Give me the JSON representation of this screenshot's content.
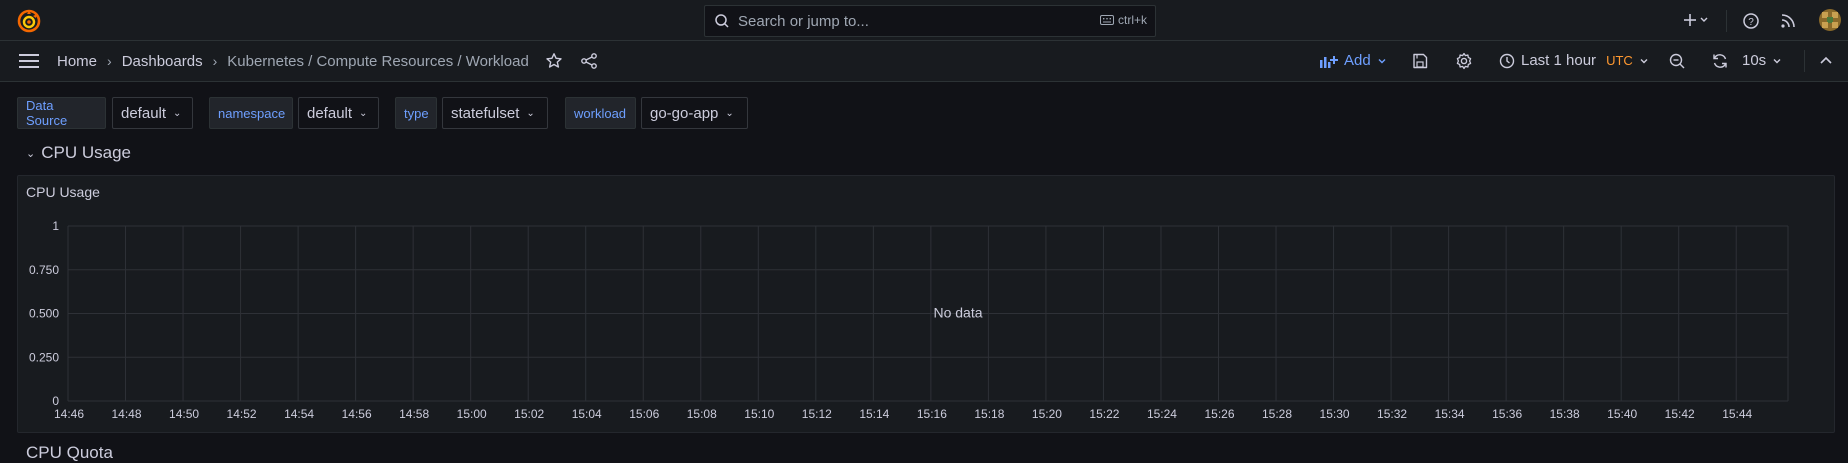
{
  "topbar": {
    "search": {
      "placeholder": "Search or jump to...",
      "shortcut": "ctrl+k"
    },
    "icons": [
      "grafana-logo-icon",
      "search-icon",
      "keyboard-icon",
      "plus-icon",
      "chevron-down-icon",
      "help-icon",
      "rss-icon",
      "avatar"
    ]
  },
  "navbar": {
    "breadcrumbs": [
      "Home",
      "Dashboards",
      "Kubernetes / Compute Resources / Workload"
    ],
    "add_label": "Add",
    "time_range": "Last 1 hour",
    "timezone": "UTC",
    "refresh_interval": "10s"
  },
  "variables": [
    {
      "label": "Data Source",
      "value": "default"
    },
    {
      "label": "namespace",
      "value": "default"
    },
    {
      "label": "type",
      "value": "statefulset"
    },
    {
      "label": "workload",
      "value": "go-go-app"
    }
  ],
  "rows": [
    {
      "title": "CPU Usage",
      "collapsed": false
    },
    {
      "title": "CPU Quota"
    }
  ],
  "panel": {
    "title": "CPU Usage",
    "no_data_text": "No data"
  },
  "chart_data": {
    "type": "line",
    "title": "CPU Usage",
    "series": [],
    "ylim": [
      0,
      1
    ],
    "y_ticks": [
      "0",
      "0.250",
      "0.500",
      "0.750",
      "1"
    ],
    "x_ticks": [
      "14:46",
      "14:48",
      "14:50",
      "14:52",
      "14:54",
      "14:56",
      "14:58",
      "15:00",
      "15:02",
      "15:04",
      "15:06",
      "15:08",
      "15:10",
      "15:12",
      "15:14",
      "15:16",
      "15:18",
      "15:20",
      "15:22",
      "15:24",
      "15:26",
      "15:28",
      "15:30",
      "15:32",
      "15:34",
      "15:36",
      "15:38",
      "15:40",
      "15:42",
      "15:44"
    ],
    "grid": true,
    "annotation": "No data"
  },
  "colors": {
    "background": "#111217",
    "panel": "#181b1f",
    "accent_blue": "#6e9fff",
    "utc_orange": "#ff9830"
  }
}
